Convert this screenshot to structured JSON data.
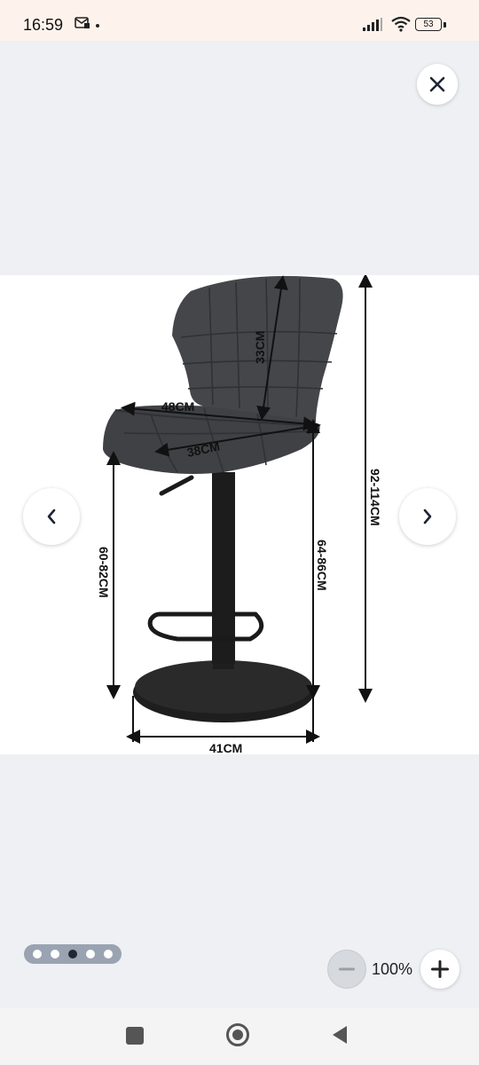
{
  "status_bar": {
    "time": "16:59",
    "battery": "53",
    "icons": [
      "message-icon",
      "signal-icon",
      "wifi-icon",
      "battery-icon"
    ]
  },
  "viewer": {
    "close_icon": "close-icon",
    "prev_icon": "chevron-left-icon",
    "next_icon": "chevron-right-icon",
    "slide_count": 5,
    "active_slide": 3,
    "zoom_level": "100%",
    "zoom_out_icon": "minus-icon",
    "zoom_in_icon": "plus-icon"
  },
  "product_image": {
    "dimensions": {
      "seat_width": "48CM",
      "seat_depth": "38CM",
      "backrest_height": "33CM",
      "total_height": "92-114CM",
      "seat_height_front": "60-82CM",
      "seat_height_back": "64-86CM",
      "base_diameter": "41CM"
    },
    "colors": {
      "upholstery": "#3f4145",
      "metal": "#1c1c1c"
    }
  },
  "nav_bar": {
    "icons": [
      "recents-icon",
      "home-icon",
      "back-icon"
    ]
  }
}
